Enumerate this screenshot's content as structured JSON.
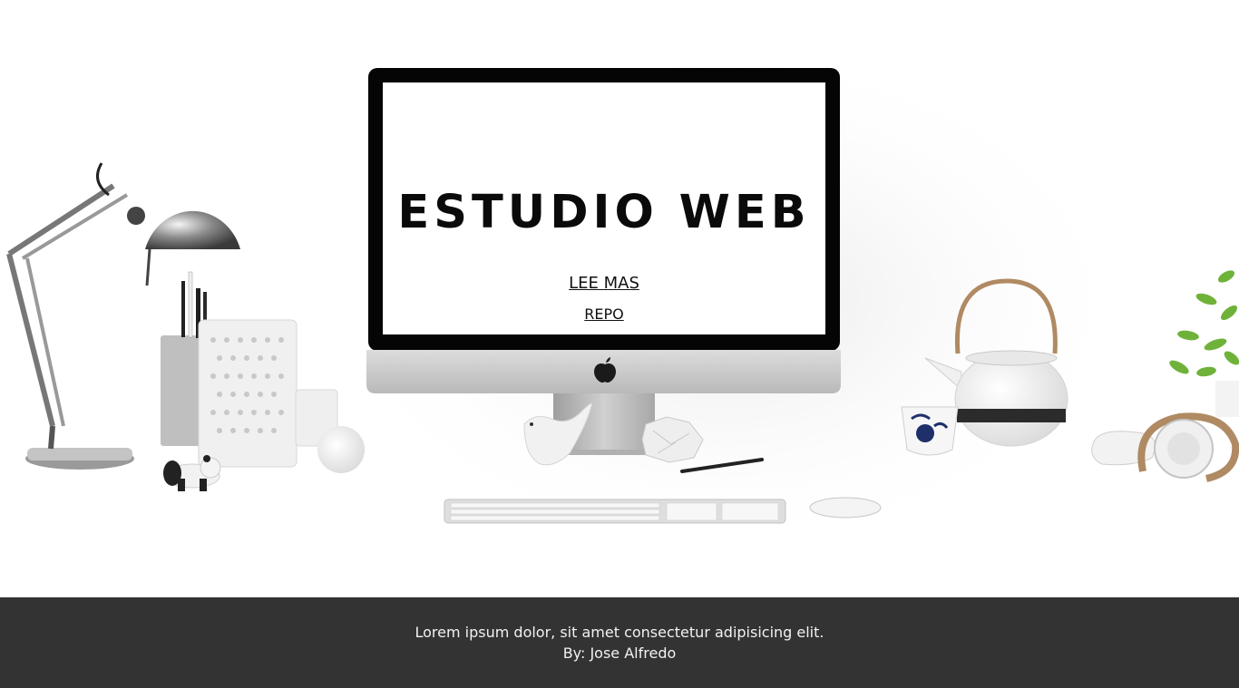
{
  "hero": {
    "title": "ESTUDIO WEB",
    "links": {
      "read_more": "LEE MAS",
      "repo": "REPO"
    }
  },
  "footer": {
    "description": "Lorem ipsum dolor, sit amet consectetur adipisicing elit.",
    "author": "By: Jose Alfredo"
  },
  "colors": {
    "footer_background": "#333333",
    "footer_text": "#f2f2f2",
    "title": "#0a0a0a",
    "page_background": "#ffffff"
  },
  "icons": [
    "desk-lamp-icon",
    "pencil-cup-icon",
    "apple-logo-icon",
    "teapot-icon",
    "headphones-icon",
    "plant-icon",
    "keyboard-icon",
    "mouse-icon",
    "panda-figurine-icon"
  ]
}
